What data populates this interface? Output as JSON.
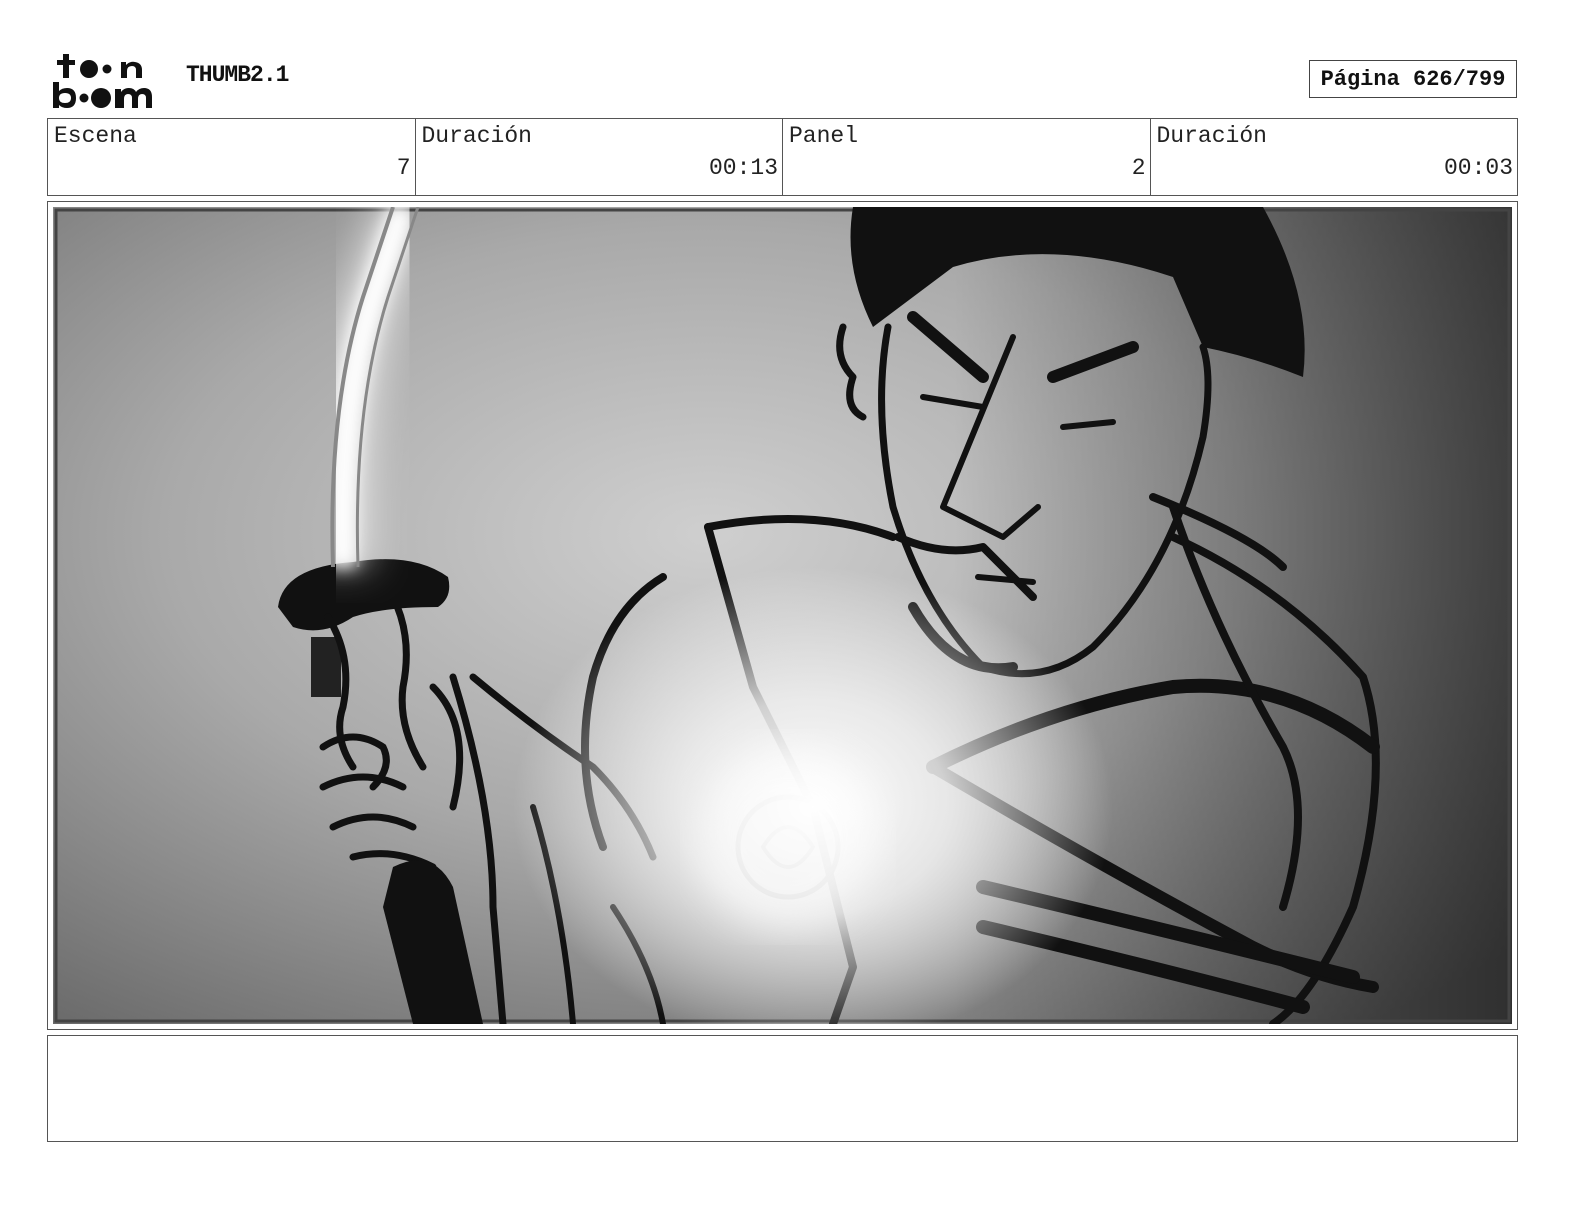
{
  "header": {
    "logo_text": "toon boom",
    "project_title": "THUMB2.1",
    "page_label": "Página 626/799"
  },
  "info": {
    "scene_label": "Escena",
    "scene_value": "7",
    "scene_duration_label": "Duración",
    "scene_duration_value": "00:13",
    "panel_label": "Panel",
    "panel_value": "2",
    "panel_duration_label": "Duración",
    "panel_duration_value": "00:03"
  },
  "panel": {
    "image_subject": "storyboard-sketch-swordsman-glowing-blade"
  },
  "notes": {
    "text": ""
  }
}
